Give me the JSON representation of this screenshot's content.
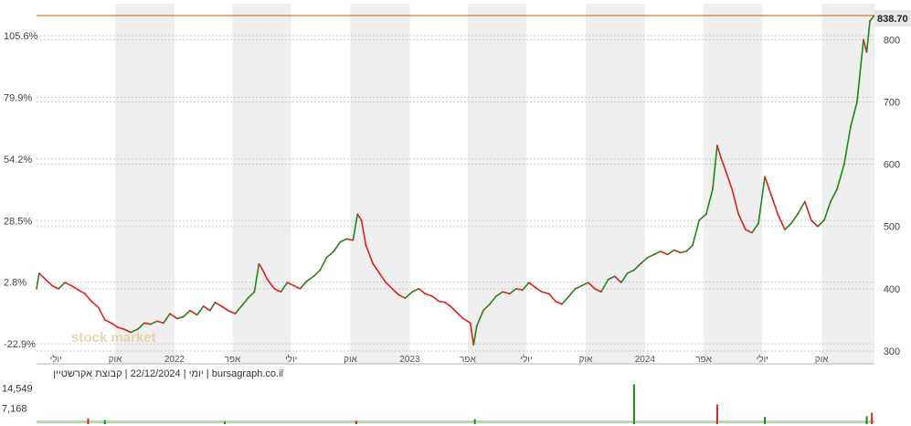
{
  "chart_data": {
    "type": "line",
    "title": "",
    "watermark": "stock market",
    "credit_line": "יומי | 22/12/2024 | קבוצת אקרשטיין | bursagraph.co.il",
    "last_price_label": "838.70",
    "last_price": 838.7,
    "x_tick_labels": [
      {
        "label": "יולי",
        "date": "2021-07-01"
      },
      {
        "label": "אוק",
        "date": "2021-10-01"
      },
      {
        "label": "2022",
        "date": "2022-01-01"
      },
      {
        "label": "אפר",
        "date": "2022-04-01"
      },
      {
        "label": "יולי",
        "date": "2022-07-01"
      },
      {
        "label": "אוק",
        "date": "2022-10-01"
      },
      {
        "label": "2023",
        "date": "2023-01-01"
      },
      {
        "label": "אפר",
        "date": "2023-04-01"
      },
      {
        "label": "יולי",
        "date": "2023-07-01"
      },
      {
        "label": "אוק",
        "date": "2023-10-01"
      },
      {
        "label": "2024",
        "date": "2024-01-01"
      },
      {
        "label": "אפר",
        "date": "2024-04-01"
      },
      {
        "label": "יולי",
        "date": "2024-07-01"
      },
      {
        "label": "אוק",
        "date": "2024-10-01"
      }
    ],
    "left_axis_ticks": [
      "105.6%",
      "79.9%",
      "54.2%",
      "28.5%",
      "2.8%",
      "-22.9%"
    ],
    "right_axis_ticks": [
      "800",
      "700",
      "600",
      "500",
      "400",
      "300"
    ],
    "ylim": [
      290,
      845
    ],
    "xlim": [
      "2021-06-01",
      "2024-12-22"
    ],
    "series": [
      {
        "values_unit": "price",
        "points": [
          [
            "2021-06-01",
            400
          ],
          [
            "2021-06-05",
            425
          ],
          [
            "2021-06-15",
            415
          ],
          [
            "2021-06-25",
            405
          ],
          [
            "2021-07-05",
            400
          ],
          [
            "2021-07-15",
            410
          ],
          [
            "2021-07-25",
            405
          ],
          [
            "2021-08-05",
            398
          ],
          [
            "2021-08-15",
            392
          ],
          [
            "2021-08-25",
            380
          ],
          [
            "2021-09-05",
            370
          ],
          [
            "2021-09-15",
            350
          ],
          [
            "2021-09-25",
            345
          ],
          [
            "2021-10-05",
            338
          ],
          [
            "2021-10-15",
            335
          ],
          [
            "2021-10-25",
            330
          ],
          [
            "2021-11-05",
            335
          ],
          [
            "2021-11-15",
            345
          ],
          [
            "2021-11-25",
            343
          ],
          [
            "2021-12-05",
            348
          ],
          [
            "2021-12-15",
            345
          ],
          [
            "2021-12-25",
            360
          ],
          [
            "2022-01-05",
            352
          ],
          [
            "2022-01-15",
            355
          ],
          [
            "2022-01-25",
            365
          ],
          [
            "2022-02-05",
            358
          ],
          [
            "2022-02-15",
            372
          ],
          [
            "2022-02-25",
            365
          ],
          [
            "2022-03-05",
            378
          ],
          [
            "2022-03-15",
            372
          ],
          [
            "2022-03-25",
            365
          ],
          [
            "2022-04-05",
            360
          ],
          [
            "2022-04-15",
            372
          ],
          [
            "2022-04-25",
            385
          ],
          [
            "2022-05-05",
            395
          ],
          [
            "2022-05-12",
            440
          ],
          [
            "2022-05-18",
            430
          ],
          [
            "2022-05-25",
            415
          ],
          [
            "2022-06-05",
            400
          ],
          [
            "2022-06-15",
            395
          ],
          [
            "2022-06-25",
            410
          ],
          [
            "2022-07-05",
            405
          ],
          [
            "2022-07-15",
            400
          ],
          [
            "2022-07-25",
            412
          ],
          [
            "2022-08-05",
            420
          ],
          [
            "2022-08-15",
            430
          ],
          [
            "2022-08-25",
            450
          ],
          [
            "2022-09-05",
            460
          ],
          [
            "2022-09-15",
            475
          ],
          [
            "2022-09-25",
            480
          ],
          [
            "2022-10-05",
            478
          ],
          [
            "2022-10-12",
            520
          ],
          [
            "2022-10-18",
            510
          ],
          [
            "2022-10-25",
            470
          ],
          [
            "2022-11-05",
            440
          ],
          [
            "2022-11-15",
            425
          ],
          [
            "2022-11-25",
            410
          ],
          [
            "2022-12-05",
            400
          ],
          [
            "2022-12-15",
            390
          ],
          [
            "2022-12-25",
            385
          ],
          [
            "2023-01-05",
            395
          ],
          [
            "2023-01-15",
            400
          ],
          [
            "2023-01-25",
            392
          ],
          [
            "2023-02-05",
            388
          ],
          [
            "2023-02-15",
            380
          ],
          [
            "2023-02-25",
            378
          ],
          [
            "2023-03-05",
            372
          ],
          [
            "2023-03-15",
            362
          ],
          [
            "2023-03-25",
            352
          ],
          [
            "2023-04-05",
            345
          ],
          [
            "2023-04-10",
            310
          ],
          [
            "2023-04-15",
            340
          ],
          [
            "2023-04-25",
            365
          ],
          [
            "2023-05-05",
            375
          ],
          [
            "2023-05-15",
            388
          ],
          [
            "2023-05-25",
            395
          ],
          [
            "2023-06-05",
            392
          ],
          [
            "2023-06-15",
            400
          ],
          [
            "2023-06-25",
            398
          ],
          [
            "2023-07-05",
            410
          ],
          [
            "2023-07-15",
            402
          ],
          [
            "2023-07-25",
            395
          ],
          [
            "2023-08-05",
            392
          ],
          [
            "2023-08-15",
            380
          ],
          [
            "2023-08-25",
            375
          ],
          [
            "2023-09-05",
            388
          ],
          [
            "2023-09-15",
            400
          ],
          [
            "2023-09-25",
            405
          ],
          [
            "2023-10-05",
            410
          ],
          [
            "2023-10-15",
            400
          ],
          [
            "2023-10-25",
            395
          ],
          [
            "2023-11-05",
            415
          ],
          [
            "2023-11-15",
            420
          ],
          [
            "2023-11-25",
            410
          ],
          [
            "2023-12-05",
            425
          ],
          [
            "2023-12-15",
            430
          ],
          [
            "2023-12-25",
            440
          ],
          [
            "2024-01-05",
            450
          ],
          [
            "2024-01-15",
            455
          ],
          [
            "2024-01-25",
            460
          ],
          [
            "2024-02-05",
            455
          ],
          [
            "2024-02-15",
            462
          ],
          [
            "2024-02-25",
            458
          ],
          [
            "2024-03-05",
            460
          ],
          [
            "2024-03-15",
            470
          ],
          [
            "2024-03-25",
            510
          ],
          [
            "2024-04-05",
            520
          ],
          [
            "2024-04-15",
            560
          ],
          [
            "2024-04-22",
            630
          ],
          [
            "2024-04-28",
            610
          ],
          [
            "2024-05-05",
            590
          ],
          [
            "2024-05-15",
            560
          ],
          [
            "2024-05-25",
            520
          ],
          [
            "2024-06-05",
            495
          ],
          [
            "2024-06-15",
            490
          ],
          [
            "2024-06-25",
            505
          ],
          [
            "2024-07-05",
            580
          ],
          [
            "2024-07-15",
            550
          ],
          [
            "2024-07-25",
            520
          ],
          [
            "2024-08-05",
            495
          ],
          [
            "2024-08-15",
            505
          ],
          [
            "2024-08-25",
            520
          ],
          [
            "2024-09-05",
            540
          ],
          [
            "2024-09-15",
            510
          ],
          [
            "2024-09-25",
            500
          ],
          [
            "2024-10-05",
            510
          ],
          [
            "2024-10-15",
            540
          ],
          [
            "2024-10-25",
            560
          ],
          [
            "2024-11-05",
            600
          ],
          [
            "2024-11-15",
            660
          ],
          [
            "2024-11-25",
            700
          ],
          [
            "2024-12-05",
            800
          ],
          [
            "2024-12-10",
            780
          ],
          [
            "2024-12-15",
            830
          ],
          [
            "2024-12-22",
            838.7
          ]
        ]
      }
    ],
    "volume_axis_ticks": [
      "14,549",
      "7,168"
    ],
    "volume_spikes": [
      [
        "2021-08-20",
        2100
      ],
      [
        "2021-09-15",
        1500
      ],
      [
        "2022-03-20",
        900
      ],
      [
        "2022-10-10",
        1200
      ],
      [
        "2023-04-12",
        1800
      ],
      [
        "2023-12-15",
        14549
      ],
      [
        "2024-04-22",
        7168
      ],
      [
        "2024-07-05",
        2600
      ],
      [
        "2024-12-10",
        2900
      ],
      [
        "2024-12-18",
        4200
      ]
    ],
    "colors": {
      "up": "#1a8a1a",
      "down": "#e0201b",
      "last_price_line": "#d35400",
      "grid": "#c9c9c9",
      "month_band": "#efefef",
      "label_box": "#e6e6e6"
    }
  }
}
